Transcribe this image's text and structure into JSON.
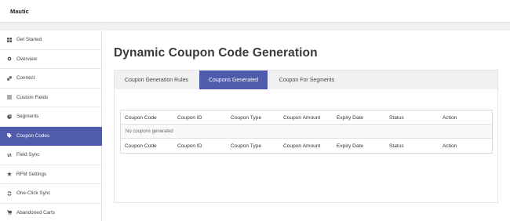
{
  "app": {
    "title": "Mautic"
  },
  "sidebar": {
    "items": [
      {
        "label": "Get Started",
        "icon": "grid-icon"
      },
      {
        "label": "Overview",
        "icon": "gear-icon"
      },
      {
        "label": "Connect",
        "icon": "link-icon"
      },
      {
        "label": "Custom Fields",
        "icon": "list-icon"
      },
      {
        "label": "Segments",
        "icon": "segments-icon"
      },
      {
        "label": "Coupon Codes",
        "icon": "tag-icon",
        "active": true
      },
      {
        "label": "Field Sync",
        "icon": "exchange-icon"
      },
      {
        "label": "RFM Settings",
        "icon": "star-icon"
      },
      {
        "label": "One-Click Sync",
        "icon": "refresh-icon"
      },
      {
        "label": "Abandoned Carts",
        "icon": "cart-icon"
      }
    ]
  },
  "main": {
    "title": "Dynamic Coupon Code Generation",
    "tabs": [
      {
        "label": "Coupon Generation Rules"
      },
      {
        "label": "Coupons Generated",
        "active": true
      },
      {
        "label": "Coupon For Segments"
      }
    ],
    "table": {
      "columns": [
        "Coupon Code",
        "Coupon ID",
        "Coupon Type",
        "Coupon Amount",
        "Expiry Date",
        "Status",
        "Action"
      ],
      "empty_message": "No coupons generated"
    }
  },
  "colors": {
    "accent": "#4e5cab",
    "band": "#f1f1f1"
  }
}
